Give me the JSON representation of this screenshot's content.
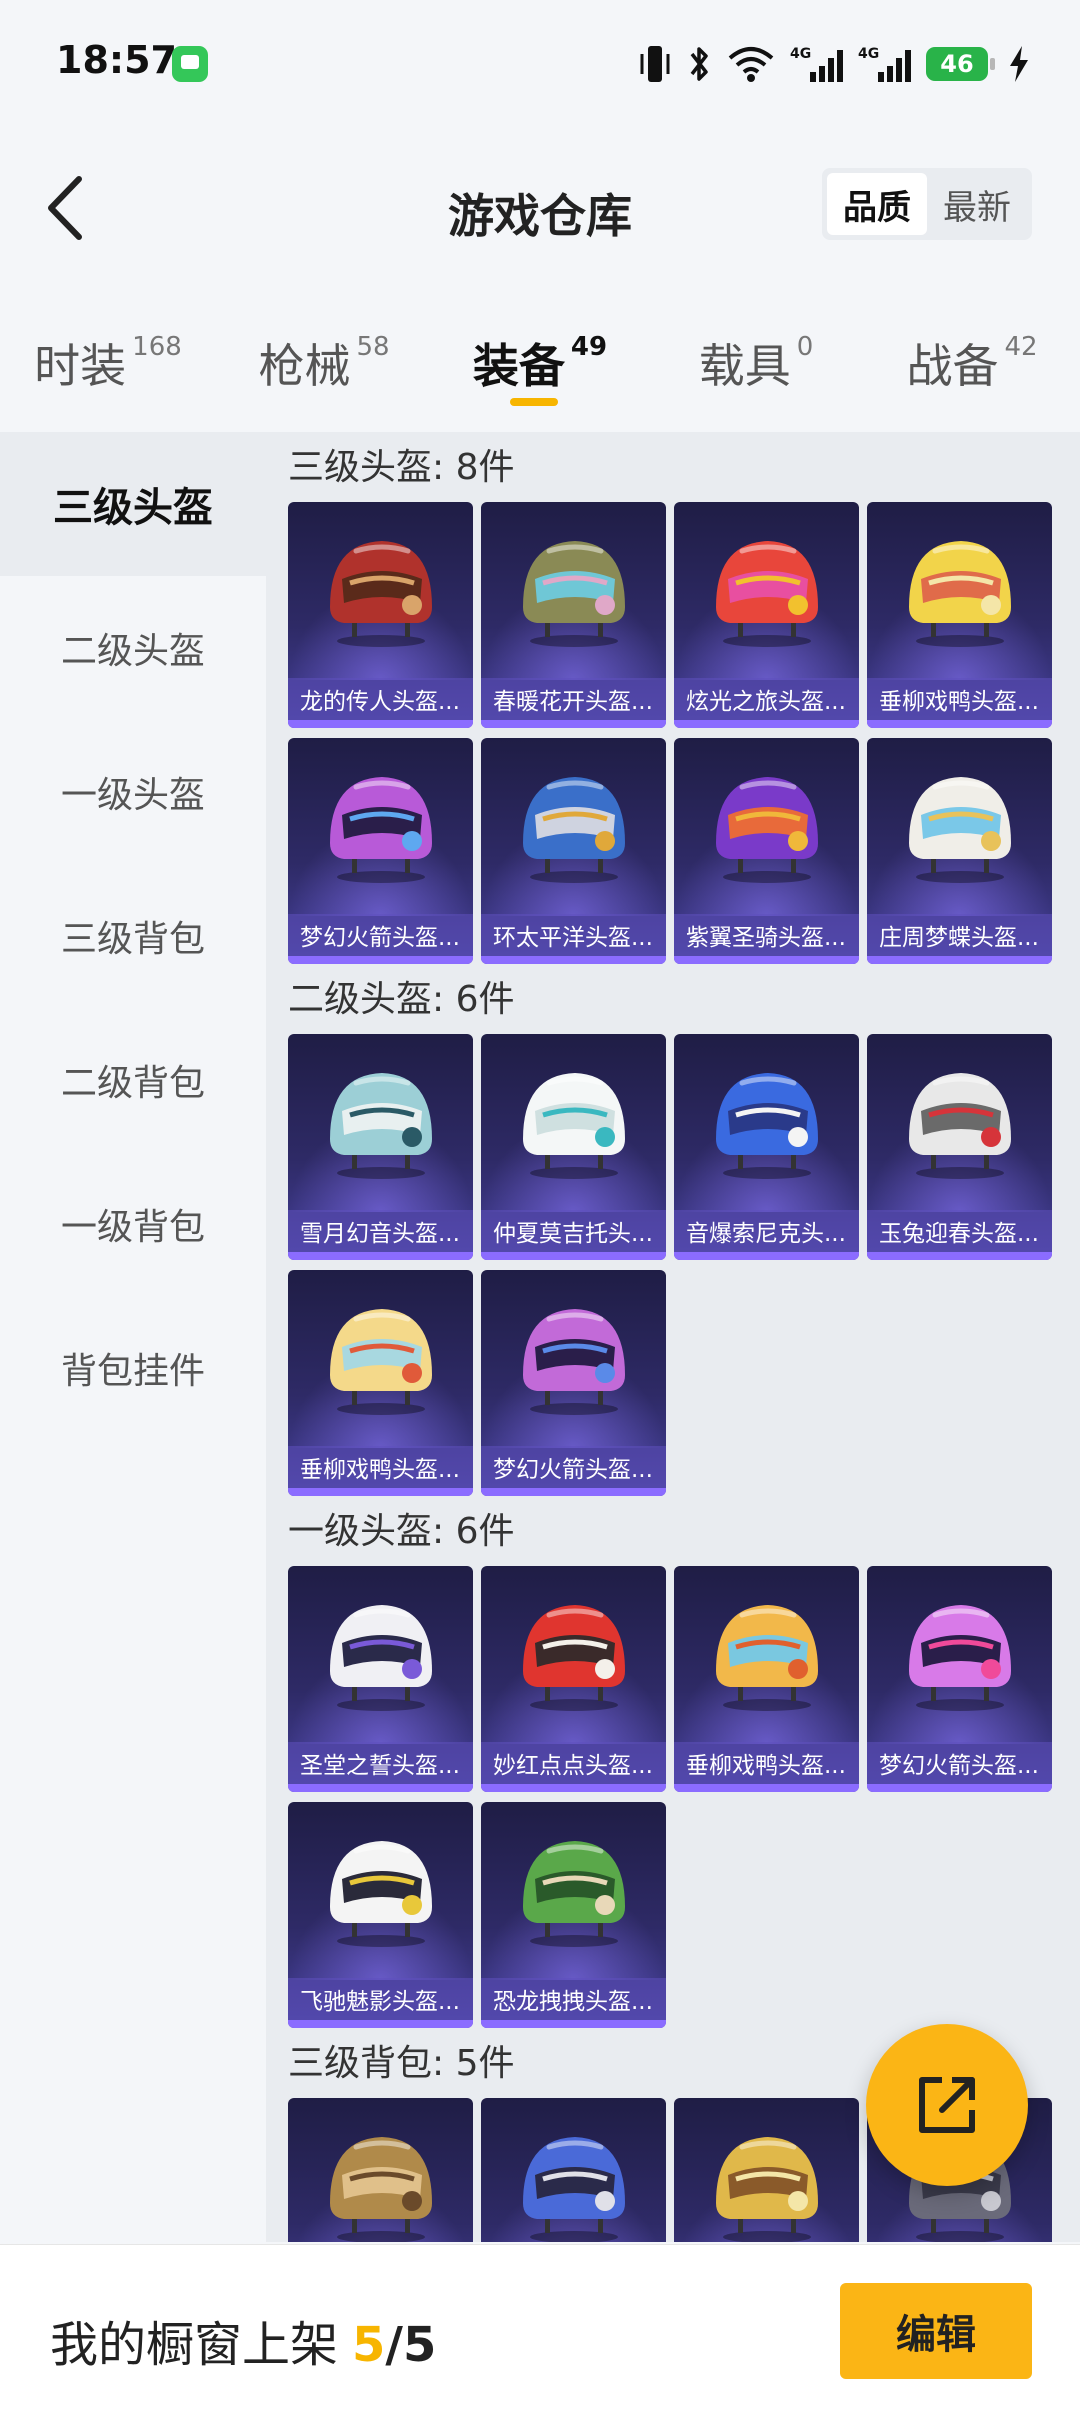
{
  "status_bar": {
    "time": "18:57",
    "battery": "46",
    "icons": [
      "message-icon",
      "vibrate-icon",
      "bluetooth-icon",
      "wifi-icon",
      "signal-4g-icon",
      "signal-4g-icon",
      "battery-icon",
      "charging-icon"
    ]
  },
  "header": {
    "title": "游戏仓库",
    "sort_options": [
      "品质",
      "最新"
    ],
    "sort_active": "品质"
  },
  "tabs": [
    {
      "label": "时装",
      "count": "168"
    },
    {
      "label": "枪械",
      "count": "58"
    },
    {
      "label": "装备",
      "count": "49",
      "active": true
    },
    {
      "label": "载具",
      "count": "0"
    },
    {
      "label": "战备",
      "count": "42"
    }
  ],
  "sidebar": {
    "items": [
      "三级头盔",
      "二级头盔",
      "一级头盔",
      "三级背包",
      "二级背包",
      "一级背包",
      "背包挂件"
    ],
    "active": "三级头盔"
  },
  "sections": [
    {
      "title": "三级头盔: 8件",
      "items": [
        {
          "name": "龙的传人头盔...",
          "palette": [
            "#b0322c",
            "#d9a46a",
            "#5a2a1a"
          ]
        },
        {
          "name": "春暖花开头盔...",
          "palette": [
            "#8a8a55",
            "#e0a8c8",
            "#6fc7d6"
          ]
        },
        {
          "name": "炫光之旅头盔...",
          "palette": [
            "#e8463b",
            "#f2c12e",
            "#e84fa0"
          ]
        },
        {
          "name": "垂柳戏鸭头盔...",
          "palette": [
            "#f2d44a",
            "#f4e6a8",
            "#e06b4a"
          ]
        },
        {
          "name": "梦幻火箭头盔...",
          "palette": [
            "#b85ad8",
            "#5ea8f0",
            "#2a1e4a"
          ]
        },
        {
          "name": "环太平洋头盔...",
          "palette": [
            "#3a6fc9",
            "#e0a83a",
            "#cfd3e0"
          ]
        },
        {
          "name": "紫翼圣骑头盔...",
          "palette": [
            "#7a3ac9",
            "#f0b83a",
            "#e86a3a"
          ]
        },
        {
          "name": "庄周梦蝶头盔...",
          "palette": [
            "#f0eee8",
            "#e8c25a",
            "#7ac8e8"
          ]
        }
      ]
    },
    {
      "title": "二级头盔: 6件",
      "items": [
        {
          "name": "雪月幻音头盔...",
          "palette": [
            "#9ccfd6",
            "#2a5a66",
            "#e8f0f0"
          ]
        },
        {
          "name": "仲夏莫吉托头...",
          "palette": [
            "#f4f7f7",
            "#3ab8c0",
            "#cfe0e0"
          ]
        },
        {
          "name": "音爆索尼克头...",
          "palette": [
            "#3a6ae0",
            "#f4f4f4",
            "#2a3a8a"
          ]
        },
        {
          "name": "玉兔迎春头盔...",
          "palette": [
            "#e8e8e8",
            "#d6343a",
            "#6a6a6a"
          ]
        },
        {
          "name": "垂柳戏鸭头盔...",
          "palette": [
            "#f4d98a",
            "#e05a3a",
            "#a8d8e0"
          ]
        },
        {
          "name": "梦幻火箭头盔...",
          "palette": [
            "#c26ad8",
            "#5a8ae8",
            "#2a1e4a"
          ]
        }
      ]
    },
    {
      "title": "一级头盔: 6件",
      "items": [
        {
          "name": "圣堂之誓头盔...",
          "palette": [
            "#f0f0f4",
            "#7a5ad8",
            "#2a2a4a"
          ]
        },
        {
          "name": "妙红点点头盔...",
          "palette": [
            "#e0352f",
            "#f4f0ea",
            "#3a2a2a"
          ]
        },
        {
          "name": "垂柳戏鸭头盔...",
          "palette": [
            "#f2b84a",
            "#e0602e",
            "#7ac8e0"
          ]
        },
        {
          "name": "梦幻火箭头盔...",
          "palette": [
            "#d87ae8",
            "#f04a9a",
            "#2a1e4a"
          ]
        },
        {
          "name": "飞驰魅影头盔...",
          "palette": [
            "#f4f4f4",
            "#e8c83a",
            "#2a2a3a"
          ]
        },
        {
          "name": "恐龙拽拽头盔...",
          "palette": [
            "#5aa84a",
            "#e8d8b8",
            "#2a5a2a"
          ]
        }
      ]
    },
    {
      "title": "三级背包: 5件",
      "items": [
        {
          "name": "",
          "palette": [
            "#b08a4a",
            "#6a4a2a",
            "#e0c08a"
          ]
        },
        {
          "name": "",
          "palette": [
            "#4a6ad8",
            "#e0e0e8",
            "#2a2a4a"
          ]
        },
        {
          "name": "",
          "palette": [
            "#e0b84a",
            "#f4e6a8",
            "#8a5a2a"
          ]
        },
        {
          "name": "",
          "palette": [
            "#6a6a7a",
            "#c8c8d0",
            "#3a3a4a"
          ]
        }
      ]
    }
  ],
  "bottom_bar": {
    "label": "我的橱窗上架",
    "current": "5",
    "separator": "/",
    "total": "5",
    "edit_label": "编辑"
  },
  "colors": {
    "accent": "#f7b500",
    "fab": "#fbb515",
    "card_bg_top": "#1f1d45",
    "card_bg_bottom": "#45409a",
    "card_name_bar": "#8b6cff"
  },
  "fab_icon": "share-external-icon"
}
